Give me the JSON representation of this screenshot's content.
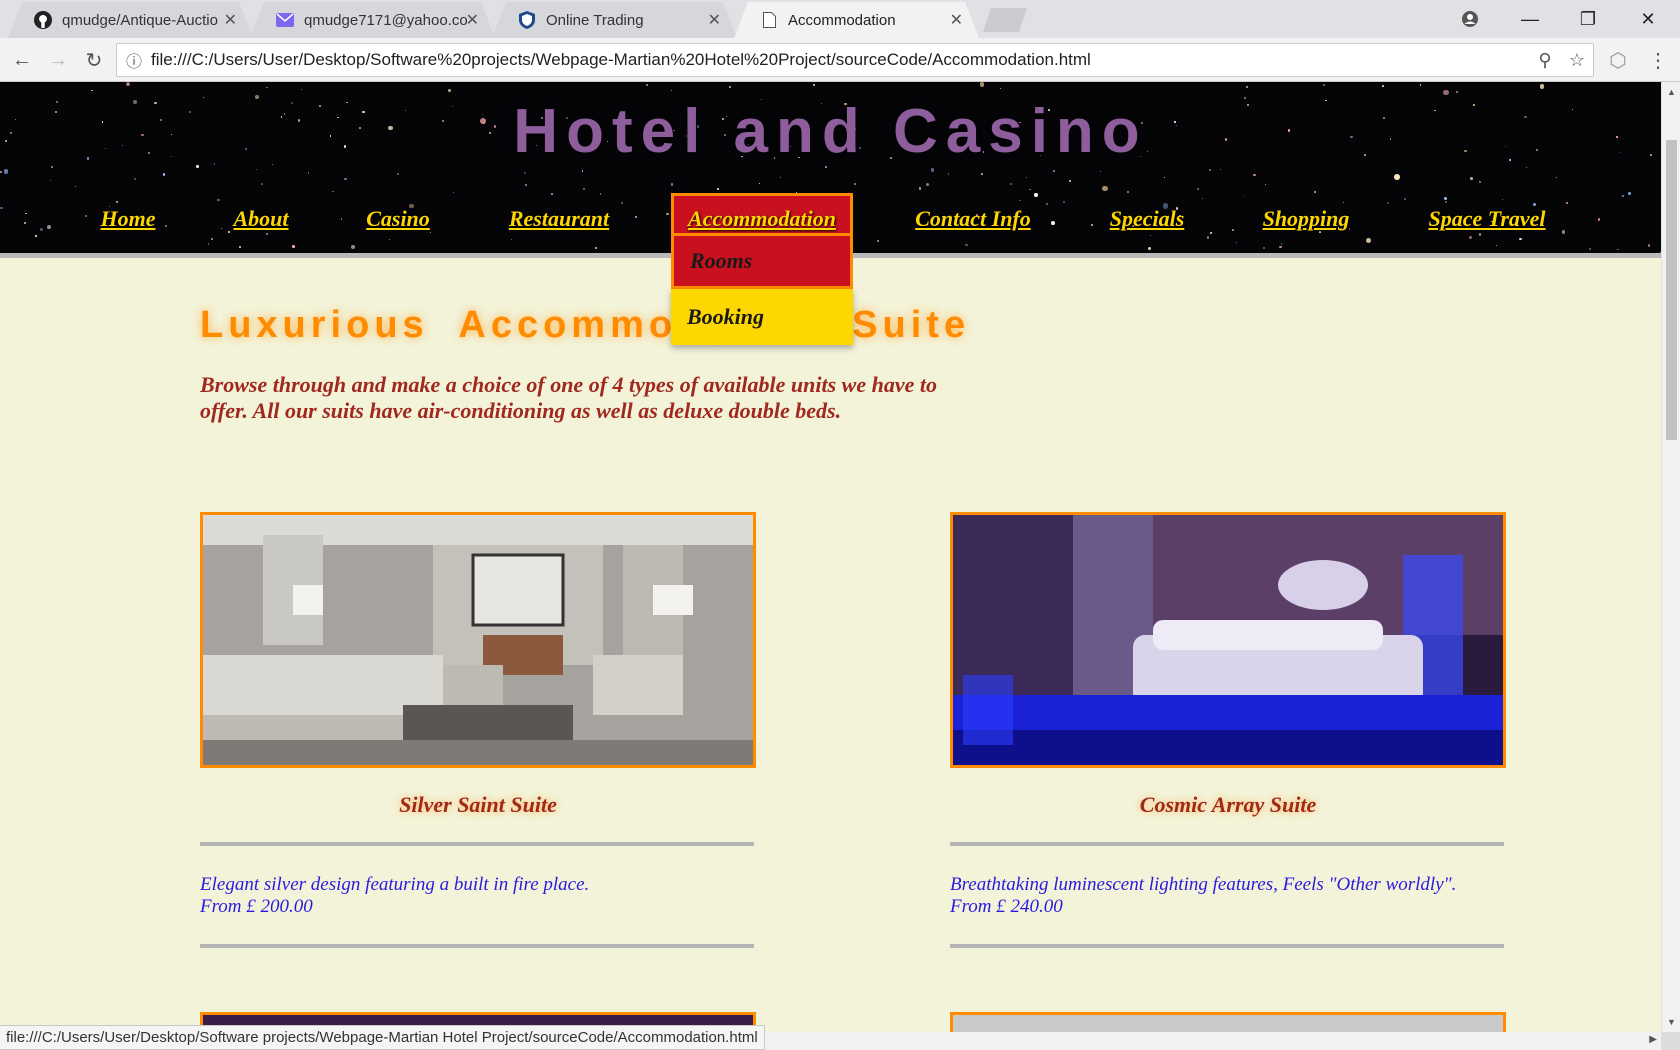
{
  "browser": {
    "tabs": [
      {
        "label": "qmudge/Antique-Auctio",
        "icon": "github-icon"
      },
      {
        "label": "qmudge7171@yahoo.co",
        "icon": "mail-icon"
      },
      {
        "label": "Online Trading",
        "icon": "bank-icon"
      },
      {
        "label": "Accommodation",
        "icon": "page-icon"
      }
    ],
    "address": "file:///C:/Users/User/Desktop/Software%20projects/Webpage-Martian%20Hotel%20Project/sourceCode/Accommodation.html",
    "status_url": "file:///C:/Users/User/Desktop/Software projects/Webpage-Martian Hotel Project/sourceCode/Accommodation.html"
  },
  "site": {
    "title": "Hotel and Casino",
    "nav": [
      "Home",
      "About",
      "Casino",
      "Restaurant",
      "Accommodation",
      "Contact Info",
      "Specials",
      "Shopping",
      "Space Travel"
    ],
    "active_nav": "Accommodation",
    "dropdown": [
      "Rooms",
      "Booking"
    ]
  },
  "content": {
    "headline": "Luxurious  Accommodation  Suite",
    "intro": "Browse through and make a choice of one of 4 types of available units we have to offer. All our suits have air-conditioning as well as deluxe double beds.",
    "rooms": [
      {
        "name": "Silver Saint Suite",
        "desc": "Elegant silver design featuring a built in fire place.",
        "price": "From £ 200.00"
      },
      {
        "name": "Cosmic Array Suite",
        "desc": "Breathtaking luminescent lighting features, Feels \"Other worldly\".",
        "price": "From £ 240.00"
      }
    ]
  },
  "colors": {
    "nav_text": "#ffd700",
    "active_bg": "#c8101e",
    "accent_orange": "#ff8c00",
    "title_purple": "#8e5e9c",
    "page_bg": "#f3f3da"
  }
}
